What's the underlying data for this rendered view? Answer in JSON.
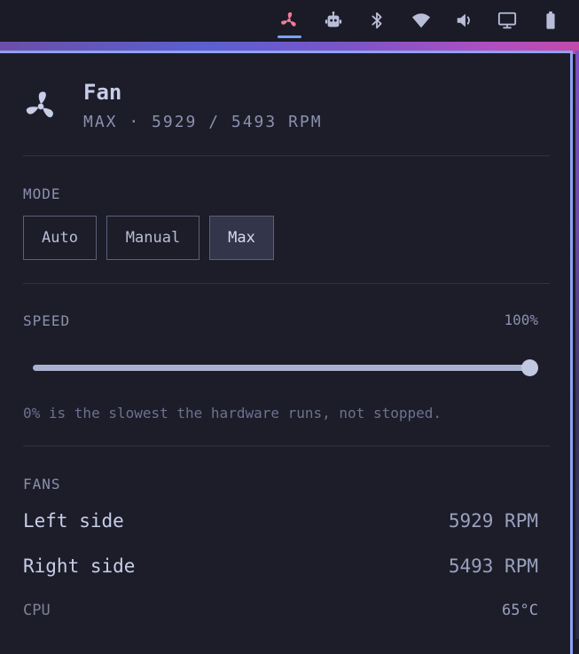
{
  "tray": {
    "items": [
      {
        "icon": "fan-icon",
        "active": true,
        "color": "#f07a9a"
      },
      {
        "icon": "robot-icon",
        "active": false
      },
      {
        "icon": "bluetooth-icon",
        "active": false
      },
      {
        "icon": "wifi-icon",
        "active": false
      },
      {
        "icon": "volume-icon",
        "active": false
      },
      {
        "icon": "display-icon",
        "active": false
      },
      {
        "icon": "battery-icon",
        "active": false
      }
    ]
  },
  "header": {
    "title": "Fan",
    "subtitle": "MAX · 5929 / 5493 RPM",
    "icon": "fan-icon"
  },
  "mode": {
    "label": "MODE",
    "options": [
      "Auto",
      "Manual",
      "Max"
    ],
    "selected": "Max"
  },
  "speed": {
    "label": "SPEED",
    "value_text": "100%",
    "value": 1.0,
    "hint": "0% is the slowest the hardware runs, not stopped."
  },
  "fans": {
    "label": "FANS",
    "items": [
      {
        "name": "Left side",
        "rpm": "5929 RPM"
      },
      {
        "name": "Right side",
        "rpm": "5493 RPM"
      }
    ]
  },
  "cpu": {
    "label": "CPU",
    "temp": "65°C"
  },
  "colors": {
    "accent": "#7aa2f7",
    "fan_active": "#f07a9a",
    "background": "#1c1d29"
  }
}
